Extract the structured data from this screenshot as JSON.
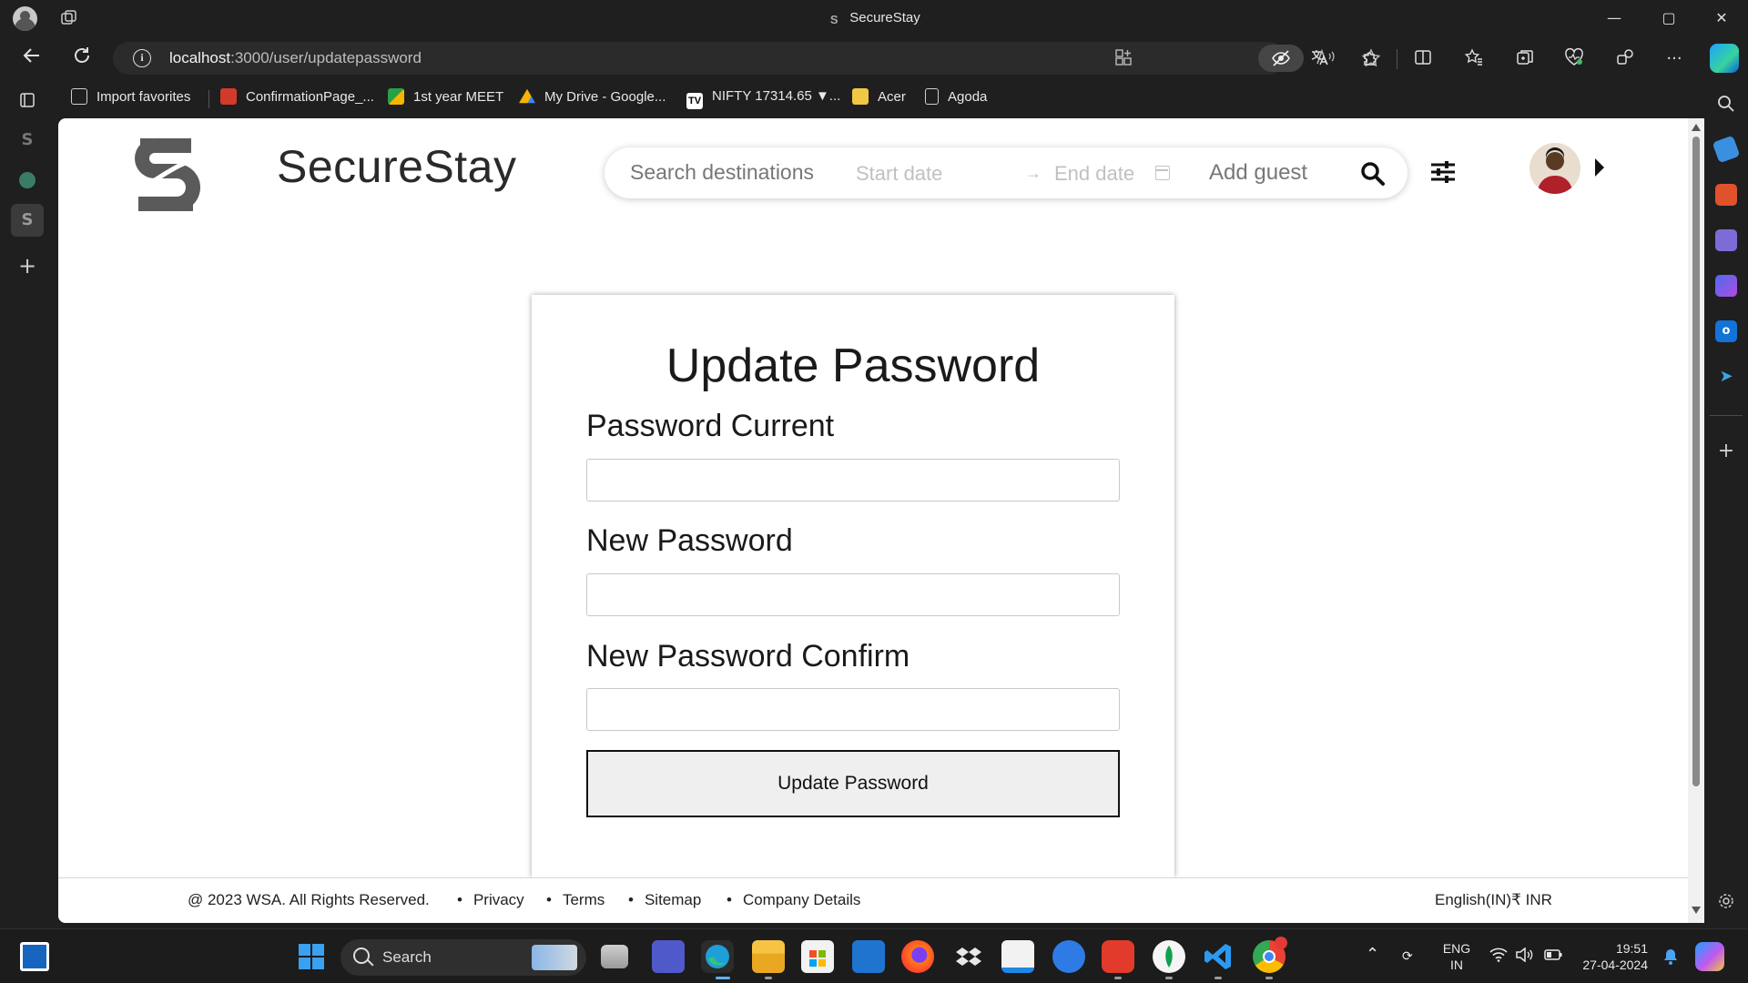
{
  "browser": {
    "window_title": "SecureStay",
    "tab_favicon_letter": "S",
    "url_host": "localhost",
    "url_path": ":3000/user/updatepassword",
    "window_controls": {
      "minimize": "—",
      "maximize": "▢",
      "close": "✕"
    }
  },
  "favorites": [
    {
      "label": "Import favorites",
      "icon": "import-icon",
      "color": "#cfcfcf"
    },
    {
      "label": "ConfirmationPage_...",
      "icon": "pdf-icon",
      "color": "#d23b2c"
    },
    {
      "label": "1st year MEET",
      "icon": "meet-icon",
      "color": "#27a048"
    },
    {
      "label": "My Drive - Google...",
      "icon": "drive-icon",
      "color": "#f7b500"
    },
    {
      "label": "NIFTY 17314.65 ▼...",
      "icon": "tradingview-icon",
      "color": "#ffffff"
    },
    {
      "label": "Acer",
      "icon": "folder-icon",
      "color": "#f2c744"
    },
    {
      "label": "Agoda",
      "icon": "page-icon",
      "color": "#cfcfcf"
    }
  ],
  "site": {
    "brand": "SecureStay",
    "search": {
      "destination_placeholder": "Search destinations",
      "start_date": "Start date",
      "date_arrow": "→",
      "end_date": "End date",
      "guest": "Add guest"
    }
  },
  "form": {
    "title": "Update Password",
    "fields": [
      {
        "label": "Password Current",
        "value": ""
      },
      {
        "label": "New Password",
        "value": ""
      },
      {
        "label": "New Password Confirm",
        "value": ""
      }
    ],
    "submit_label": "Update Password"
  },
  "footer": {
    "copyright": "@ 2023 WSA. All Rights Reserved.",
    "links": [
      "Privacy",
      "Terms",
      "Sitemap",
      "Company Details"
    ],
    "language": "English(IN)₹ INR"
  },
  "taskbar": {
    "search_label": "Search",
    "lang_line1": "ENG",
    "lang_line2": "IN",
    "time": "19:51",
    "date": "27-04-2024"
  },
  "colors": {
    "accent_brand": "#2a2a2a",
    "browser_chrome": "#1f1f1f",
    "page_background": "#ffffff",
    "button_background": "#efefef"
  }
}
